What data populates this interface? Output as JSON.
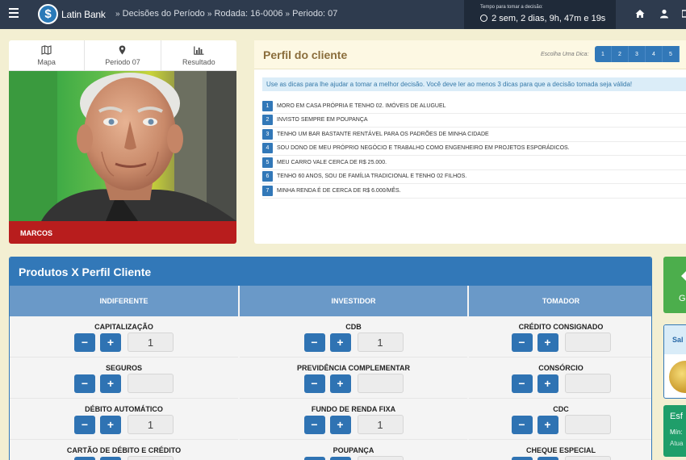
{
  "topbar": {
    "logo_symbol": "$",
    "logo_text": "Latin Bank",
    "breadcrumb": {
      "item1": "Decisões do Período",
      "item2": "Rodada: 16-0006",
      "item3": "Periodo: 07"
    },
    "timer_label": "Tempo para tomar a decisão:",
    "timer_value": "2 sem, 2 dias, 9h, 47m e 19s",
    "icons": [
      "menu-icon",
      "home-icon",
      "user-icon"
    ]
  },
  "left_card": {
    "tabs": [
      {
        "label": "Mapa",
        "icon": "map-icon"
      },
      {
        "label": "Periodo 07",
        "icon": "map-marker-icon"
      },
      {
        "label": "Resultado",
        "icon": "bar-chart-icon"
      }
    ],
    "client_name": "MARCOS"
  },
  "perfil": {
    "title": "Perfil do cliente",
    "dica_label": "Escolha Uma Dica:",
    "dica_buttons": [
      "1",
      "2",
      "3",
      "4",
      "5"
    ],
    "info": "Use as dicas para lhe ajudar a tomar a melhor decisão. Você deve ler ao menos 3 dicas para que a decisão tomada seja válida!",
    "hints": [
      {
        "num": "1",
        "text": "MORO EM CASA PRÓPRIA E TENHO 02. IMÓVEIS DE ALUGUEL"
      },
      {
        "num": "2",
        "text": "INVISTO SEMPRE EM POUPANÇA"
      },
      {
        "num": "3",
        "text": "TENHO UM BAR BASTANTE RENTÁVEL PARA OS PADRÕES DE MINHA CIDADE"
      },
      {
        "num": "4",
        "text": "SOU DONO DE MEU PRÓPRIO NEGÓCIO E TRABALHO COMO ENGENHEIRO EM PROJETOS ESPORÁDICOS."
      },
      {
        "num": "5",
        "text": "MEU CARRO VALE CERCA DE R$ 25.000."
      },
      {
        "num": "6",
        "text": "TENHO 60 ANOS, SOU DE FAMÍLIA TRADICIONAL E TENHO 02 FILHOS."
      },
      {
        "num": "7",
        "text": "MINHA RENDA É DE CERCA DE R$ 6.000/MÊS."
      }
    ]
  },
  "produtos": {
    "title": "Produtos X Perfil Cliente",
    "minus": "−",
    "plus": "+",
    "columns": [
      {
        "header": "INDIFERENTE",
        "items": [
          {
            "name": "CAPITALIZAÇÃO",
            "qty": "1"
          },
          {
            "name": "SEGUROS",
            "qty": ""
          },
          {
            "name": "DÉBITO AUTOMÁTICO",
            "qty": "1"
          },
          {
            "name": "CARTÃO DE DÉBITO E CRÉDITO",
            "qty": ""
          }
        ]
      },
      {
        "header": "INVESTIDOR",
        "items": [
          {
            "name": "CDB",
            "qty": "1"
          },
          {
            "name": "PREVIDÊNCIA COMPLEMENTAR",
            "qty": ""
          },
          {
            "name": "FUNDO DE RENDA FIXA",
            "qty": "1"
          },
          {
            "name": "POUPANÇA",
            "qty": ""
          }
        ]
      },
      {
        "header": "TOMADOR",
        "items": [
          {
            "name": "CRÉDITO CONSIGNADO",
            "qty": ""
          },
          {
            "name": "CONSÓRCIO",
            "qty": ""
          },
          {
            "name": "CDC",
            "qty": ""
          },
          {
            "name": "CHEQUE ESPECIAL",
            "qty": ""
          }
        ]
      }
    ]
  },
  "right_edge": {
    "green_text": "G",
    "sal_text": "Sal",
    "esf_title": "Esf",
    "esf_min": "Mín:",
    "esf_atual": "Atua"
  },
  "colors": {
    "topbar": "#2e3b4e",
    "primary": "#3278b8",
    "name_bar": "#b81d1d",
    "page_bg": "#f3efd2"
  }
}
